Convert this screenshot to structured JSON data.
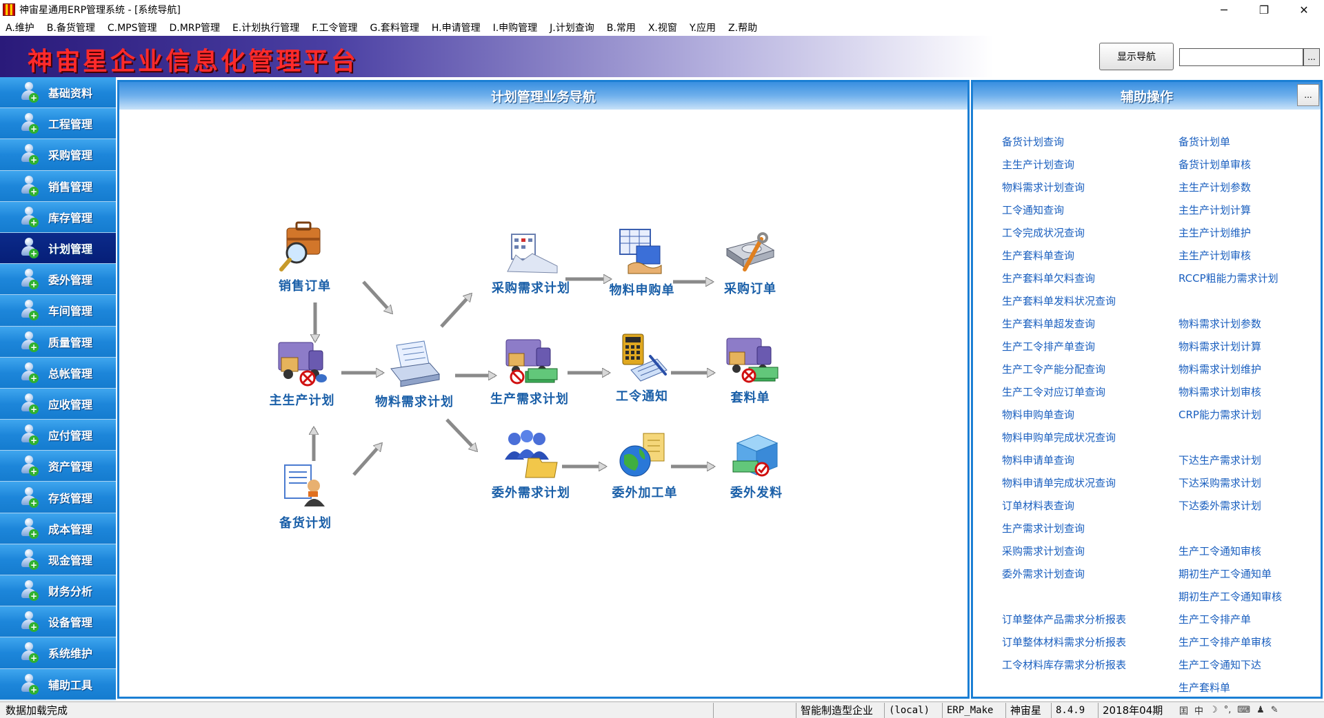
{
  "window": {
    "title": "神宙星通用ERP管理系统 - [系统导航]",
    "minimize_glyph": "─",
    "restore_glyph": "❐",
    "close_glyph": "✕"
  },
  "menu": [
    "A.维护",
    "B.备货管理",
    "C.MPS管理",
    "D.MRP管理",
    "E.计划执行管理",
    "F.工令管理",
    "G.套料管理",
    "H.申请管理",
    "I.申购管理",
    "J.计划查询",
    "B.常用",
    "X.视窗",
    "Y.应用",
    "Z.帮助"
  ],
  "banner": {
    "title": "神宙星企业信息化管理平台",
    "toggle_nav_label": "显示导航",
    "search_value": "",
    "more_label": "..."
  },
  "sidebar": {
    "items": [
      "基础资料",
      "工程管理",
      "采购管理",
      "销售管理",
      "库存管理",
      "计划管理",
      "委外管理",
      "车间管理",
      "质量管理",
      "总帐管理",
      "应收管理",
      "应付管理",
      "资产管理",
      "存货管理",
      "成本管理",
      "现金管理",
      "财务分析",
      "设备管理",
      "系统维护",
      "辅助工具"
    ],
    "active": "计划管理"
  },
  "main": {
    "title": "计划管理业务导航",
    "nodes": {
      "sales_order": "销售订单",
      "mps": "主生产计划",
      "stock_plan": "备货计划",
      "mrp": "物料需求计划",
      "purchase_req_plan": "采购需求计划",
      "material_requisition": "物料申购单",
      "purchase_order": "采购订单",
      "production_req_plan": "生产需求计划",
      "work_order_notice": "工令通知",
      "kitting_order": "套料单",
      "outsource_req_plan": "委外需求计划",
      "outsource_process_order": "委外加工单",
      "outsource_material_issue": "委外发料"
    }
  },
  "aux": {
    "title": "辅助操作",
    "more_label": "...",
    "left_links": [
      "备货计划查询",
      "主生产计划查询",
      "物料需求计划查询",
      "工令通知查询",
      "工令完成状况查询",
      "生产套料单查询",
      "生产套料单欠料查询",
      "生产套料单发料状况查询",
      "生产套料单超发查询",
      "生产工令排产单查询",
      "生产工令产能分配查询",
      "生产工令对应订单查询",
      "物料申购单查询",
      "物料申购单完成状况查询",
      "物料申请单查询",
      "物料申请单完成状况查询",
      "订单材料表查询",
      "生产需求计划查询",
      "采购需求计划查询",
      "委外需求计划查询",
      "订单整体产品需求分析报表",
      "订单整体材料需求分析报表",
      "工令材料库存需求分析报表"
    ],
    "right_links": [
      "备货计划单",
      "备货计划单审核",
      "主生产计划参数",
      "主生产计划计算",
      "主生产计划维护",
      "主生产计划审核",
      "RCCP粗能力需求计划",
      "物料需求计划参数",
      "物料需求计划计算",
      "物料需求计划维护",
      "物料需求计划审核",
      "CRP能力需求计划",
      "下达生产需求计划",
      "下达采购需求计划",
      "下达委外需求计划",
      "生产工令通知审核",
      "期初生产工令通知单",
      "期初生产工令通知审核",
      "生产工令排产单",
      "生产工令排产单审核",
      "生产工令通知下达",
      "生产套料单"
    ]
  },
  "status": {
    "message": "数据加载完成",
    "company_type": "智能制造型企业",
    "server": "(local)",
    "database": "ERP_Make",
    "user": "神宙星",
    "version": "8.4.9",
    "period": "2018年04期"
  },
  "tray": {
    "ime_icon": "囯",
    "lang": "中",
    "moon": "☽",
    "punct": "°,",
    "keyboard": "⌨",
    "user": "♟",
    "tools": "✎"
  },
  "colors": {
    "accent": "#1b7fd4",
    "sidebar_active": "#061f78",
    "link": "#1a5fbf",
    "banner_title": "#ff2a2a"
  }
}
